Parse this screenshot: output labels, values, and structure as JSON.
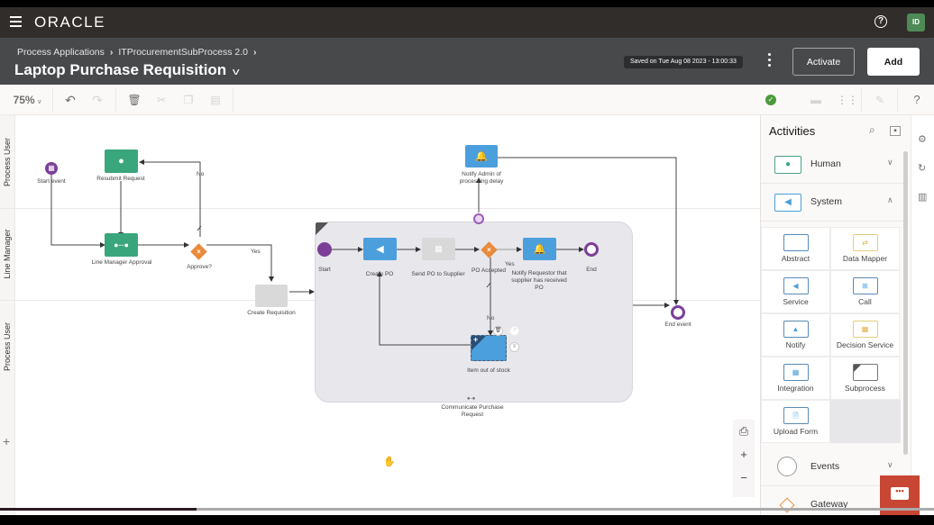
{
  "app": {
    "brand": "ORACLE",
    "avatar_initials": "ID"
  },
  "header": {
    "breadcrumbs": [
      "Process Applications",
      "ITProcurementSubProcess 2.0"
    ],
    "title": "Laptop Purchase Requisition",
    "saved_status": "Saved on Tue Aug 08 2023 - 13:00:33",
    "activate_label": "Activate",
    "add_label": "Add"
  },
  "toolbar": {
    "zoom_level": "75%",
    "icons": [
      "undo-icon",
      "redo-icon",
      "delete-icon",
      "cut-icon",
      "copy-icon",
      "paste-icon",
      "validate-icon",
      "print-icon",
      "grid-icon",
      "edit-icon",
      "help-icon"
    ]
  },
  "lanes": [
    "Process User",
    "Line Manager",
    "Process User"
  ],
  "diagram": {
    "nodes": {
      "start_event": "Start event",
      "resubmit_request": "Resubmit Request",
      "line_manager_approval": "Line Manager Approval",
      "approve_gateway": "Approve?",
      "create_requisition": "Create Requisition",
      "notify_admin": "Notify Admin of processing delay",
      "end_event": "End event",
      "sub_start": "Start",
      "create_po": "Create PO",
      "send_po": "Send PO to Supplier",
      "po_accepted": "PO Accepted",
      "notify_requestor": "Notify Requestor that supplier has received PO",
      "sub_end": "End",
      "item_out_of_stock": "Item out of stock",
      "subprocess": "Communicate Purchase Request"
    },
    "flow_labels": {
      "no_1": "No",
      "yes_1": "Yes",
      "yes_2": "Yes",
      "no_2": "No"
    }
  },
  "panel": {
    "title": "Activities",
    "categories": [
      {
        "label": "Human",
        "expanded": false
      },
      {
        "label": "System",
        "expanded": true
      },
      {
        "label": "Events",
        "expanded": false
      },
      {
        "label": "Gateway",
        "expanded": false
      }
    ],
    "system_items": [
      "Abstract",
      "Data Mapper",
      "Service",
      "Call",
      "Notify",
      "Decision Service",
      "Integration",
      "Subprocess",
      "Upload Form"
    ]
  },
  "colors": {
    "human": "#3aa67c",
    "system": "#4b9fdc",
    "gateway": "#e98a3c",
    "event": "#7b3f98",
    "chat": "#c74634"
  }
}
